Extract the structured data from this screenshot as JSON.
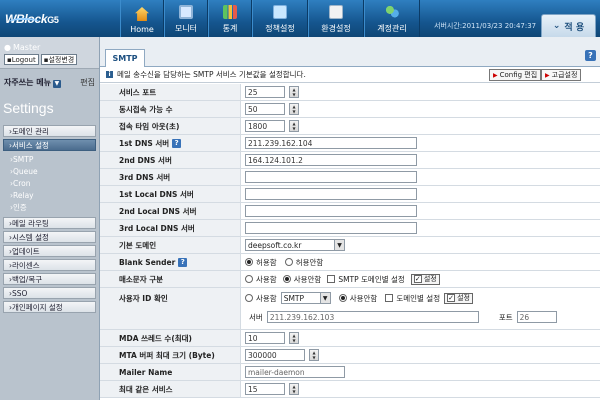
{
  "app": {
    "logo": "WBlock",
    "logo_suffix": "G5",
    "server_time": "서버시간:2011/03/23 20:47:37",
    "apply_label": "적 용"
  },
  "nav": [
    {
      "label": "Home",
      "icon": "home-icon"
    },
    {
      "label": "모니터",
      "icon": "monitor-icon"
    },
    {
      "label": "통계",
      "icon": "stats-icon"
    },
    {
      "label": "정책설정",
      "icon": "policy-icon"
    },
    {
      "label": "환경설정",
      "icon": "environment-icon"
    },
    {
      "label": "계정관리",
      "icon": "account-icon"
    }
  ],
  "sidebar": {
    "user": "Master",
    "logout": "Logout",
    "env_change": "설정변경",
    "favorites": "자주쓰는 메뉴",
    "favorites_edit": "편집",
    "section_title": "Settings",
    "items": [
      {
        "label": "도메인 관리",
        "type": "menu"
      },
      {
        "label": "서비스 설정",
        "type": "menu",
        "active": true
      },
      {
        "label": "SMTP",
        "type": "sub"
      },
      {
        "label": "Queue",
        "type": "sub"
      },
      {
        "label": "Cron",
        "type": "sub"
      },
      {
        "label": "Relay",
        "type": "sub"
      },
      {
        "label": "인증",
        "type": "sub"
      },
      {
        "label": "메일 라우팅",
        "type": "menu"
      },
      {
        "label": "시스템 설정",
        "type": "menu"
      },
      {
        "label": "업데이트",
        "type": "menu"
      },
      {
        "label": "라이센스",
        "type": "menu"
      },
      {
        "label": "백업/복구",
        "type": "menu"
      },
      {
        "label": "SSO",
        "type": "menu"
      },
      {
        "label": "개인페이지 설정",
        "type": "menu"
      }
    ]
  },
  "content": {
    "tab": "SMTP",
    "info": "메일 송수신을 담당하는 SMTP 서비스 기본값을 설정합니다.",
    "config_edit": "Config 편집",
    "advanced": "고급설정"
  },
  "form": {
    "service_port": {
      "label": "서비스 포트",
      "value": "25"
    },
    "concurrent": {
      "label": "동시접속 가능 수",
      "value": "50"
    },
    "timeout": {
      "label": "접속 타임 아웃(초)",
      "value": "1800"
    },
    "dns1": {
      "label": "1st DNS 서버",
      "value": "211.239.162.104"
    },
    "dns2": {
      "label": "2nd DNS 서버",
      "value": "164.124.101.2"
    },
    "dns3": {
      "label": "3rd DNS 서버",
      "value": ""
    },
    "ldns1": {
      "label": "1st Local DNS 서버",
      "value": ""
    },
    "ldns2": {
      "label": "2nd Local DNS 서버",
      "value": ""
    },
    "ldns3": {
      "label": "3rd Local DNS 서버",
      "value": ""
    },
    "base_domain": {
      "label": "기본 도메인",
      "value": "deepsoft.co.kr"
    },
    "blank_sender": {
      "label": "Blank Sender",
      "allow": "허용함",
      "deny": "허용안함"
    },
    "relay": {
      "label": "매소문자 구분",
      "use": "사용함",
      "nouse": "사용안함",
      "smtp_domain": "SMTP 도메인별 설정",
      "setting": "설정"
    },
    "user_id": {
      "label": "사용자 ID 확인",
      "use": "사용함",
      "select": "SMTP",
      "nouse": "사용안함",
      "domain_setting": "도메인별 설정",
      "setting": "설정",
      "server_label": "서버",
      "server_value": "211.239.162.103",
      "port_label": "포트",
      "port_value": "26"
    },
    "mda": {
      "label": "MDA 쓰레드 수(최대)",
      "value": "10"
    },
    "mta_buffer": {
      "label": "MTA 버퍼 최대 크기 (Byte)",
      "value": "300000"
    },
    "mailer_name": {
      "label": "Mailer Name",
      "value": "mailer-daemon"
    },
    "max_same": {
      "label": "최대 같은 서비스",
      "value": "15"
    }
  }
}
